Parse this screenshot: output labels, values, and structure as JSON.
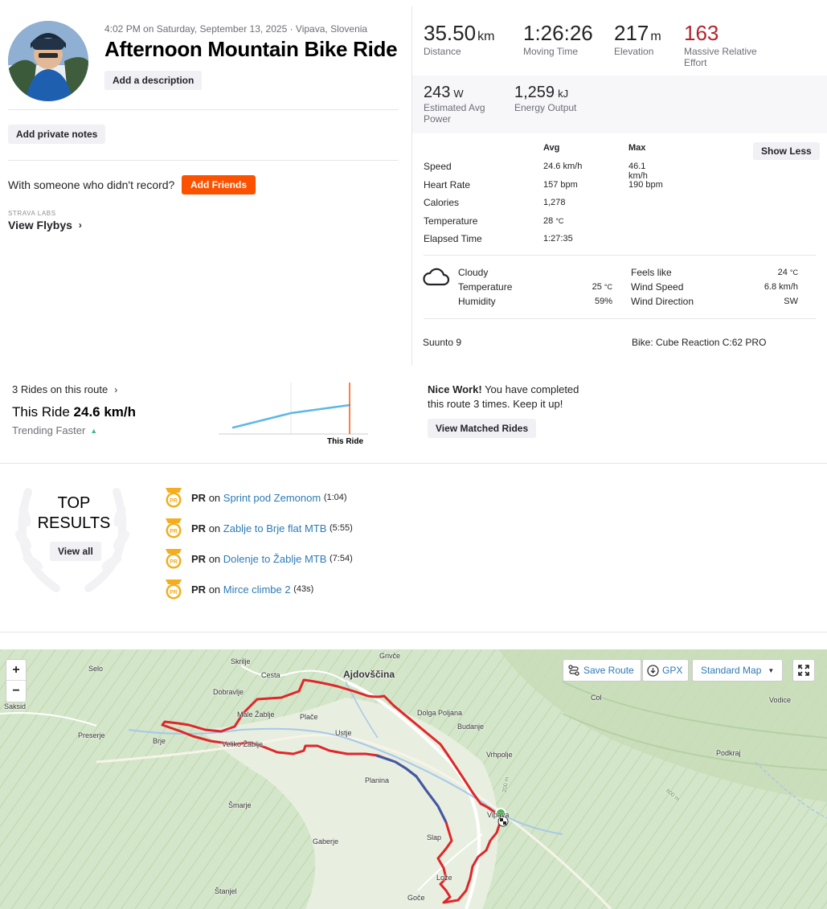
{
  "activity": {
    "datetime": "4:02 PM on Saturday, September 13, 2025 · Vipava, Slovenia",
    "title": "Afternoon Mountain Bike Ride",
    "add_description": "Add a description",
    "add_private_notes": "Add private notes",
    "with_someone": "With someone who didn't record?",
    "add_friends": "Add Friends",
    "labs_label": "STRAVA LABS",
    "view_flybys": "View Flybys"
  },
  "primary_stats": [
    {
      "value": "35.50",
      "unit": "km",
      "label": "Distance"
    },
    {
      "value": "1:26:26",
      "unit": "",
      "label": "Moving Time"
    },
    {
      "value": "217",
      "unit": "m",
      "label": "Elevation"
    },
    {
      "value": "163",
      "unit": "",
      "label": "Massive Relative",
      "label2": "Effort"
    }
  ],
  "secondary_stats": [
    {
      "value": "243",
      "unit": "W",
      "label": "Estimated Avg",
      "label2": "Power"
    },
    {
      "value": "1,259",
      "unit": "kJ",
      "label": "Energy Output",
      "label2": ""
    }
  ],
  "detail_table": {
    "col_avg": "Avg",
    "col_max": "Max",
    "show_less": "Show Less",
    "rows": [
      {
        "label": "Speed",
        "avg": "24.6",
        "avg_unit": "km/h",
        "max": "46.1",
        "max_unit": "km/h"
      },
      {
        "label": "Heart Rate",
        "avg": "157",
        "avg_unit": "bpm",
        "max": "190",
        "max_unit": "bpm"
      },
      {
        "label": "Calories",
        "avg": "1,278",
        "avg_unit": "",
        "max": "",
        "max_unit": ""
      },
      {
        "label": "Temperature",
        "avg": "28",
        "avg_unit": "°C",
        "max": "",
        "max_unit": ""
      },
      {
        "label": "Elapsed Time",
        "avg": "1:27:35",
        "avg_unit": "",
        "max": "",
        "max_unit": ""
      }
    ]
  },
  "weather": {
    "condition": "Cloudy",
    "temperature_label": "Temperature",
    "temperature": "25",
    "temperature_unit": "°C",
    "humidity_label": "Humidity",
    "humidity": "59%",
    "feels_like_label": "Feels like",
    "feels_like": "24",
    "feels_like_unit": "°C",
    "wind_speed_label": "Wind Speed",
    "wind_speed": "6.8 km/h",
    "wind_direction_label": "Wind Direction",
    "wind_direction": "SW"
  },
  "device": {
    "name": "Suunto 9",
    "bike": "Bike: Cube Reaction C:62 PRO"
  },
  "route": {
    "rides_on_route": "3 Rides on this route",
    "this_ride_label": "This Ride",
    "this_ride_value": "24.6 km/h",
    "trending": "Trending Faster",
    "chart_label": "This Ride",
    "nice_work_bold": "Nice Work!",
    "nice_work_text": "You have completed",
    "nice_work_text2": "this route 3 times. Keep it up!",
    "view_matched": "View Matched Rides"
  },
  "top_results": {
    "title_line1": "TOP",
    "title_line2": "RESULTS",
    "view_all": "View all",
    "items": [
      {
        "badge": "PR",
        "pr": "PR",
        "on": "on",
        "segment": "Sprint pod Zemonom",
        "time": "(1:04)"
      },
      {
        "badge": "PR",
        "pr": "PR",
        "on": "on",
        "segment": "Zablje to Brje flat MTB",
        "time": "(5:55)"
      },
      {
        "badge": "PR",
        "pr": "PR",
        "on": "on",
        "segment": "Dolenje to Žablje MTB",
        "time": "(7:54)"
      },
      {
        "badge": "PR",
        "pr": "PR",
        "on": "on",
        "segment": "Mirce climbe 2",
        "time": "(43s)"
      }
    ]
  },
  "map": {
    "zoom_in": "+",
    "zoom_out": "−",
    "save_route": "Save Route",
    "gpx": "GPX",
    "map_style": "Standard Map",
    "labels": [
      "Grivče",
      "Selo",
      "Skrilje",
      "Cesta",
      "Ajdovščina",
      "Saksid",
      "Dobravlje",
      "Col",
      "Vodice",
      "Male Žablje",
      "Plače",
      "Dolga Poljana",
      "Budanje",
      "Preserje",
      "Brje",
      "Ustje",
      "Veliko Žablje",
      "Vrhpolje",
      "Podkraj",
      "Planina",
      "200 m",
      "600 m",
      "Šmarje",
      "Vipava",
      "Slap",
      "Gaberje",
      "Lože",
      "Štanjel",
      "Goče"
    ]
  },
  "colors": {
    "accent": "#fc5200",
    "effort": "#b3242c",
    "link": "#2d7bb6",
    "route_red": "#e0262a",
    "route_blue": "#3d5aa8",
    "chart_line": "#5bb8e6",
    "start_green": "#44b549"
  }
}
